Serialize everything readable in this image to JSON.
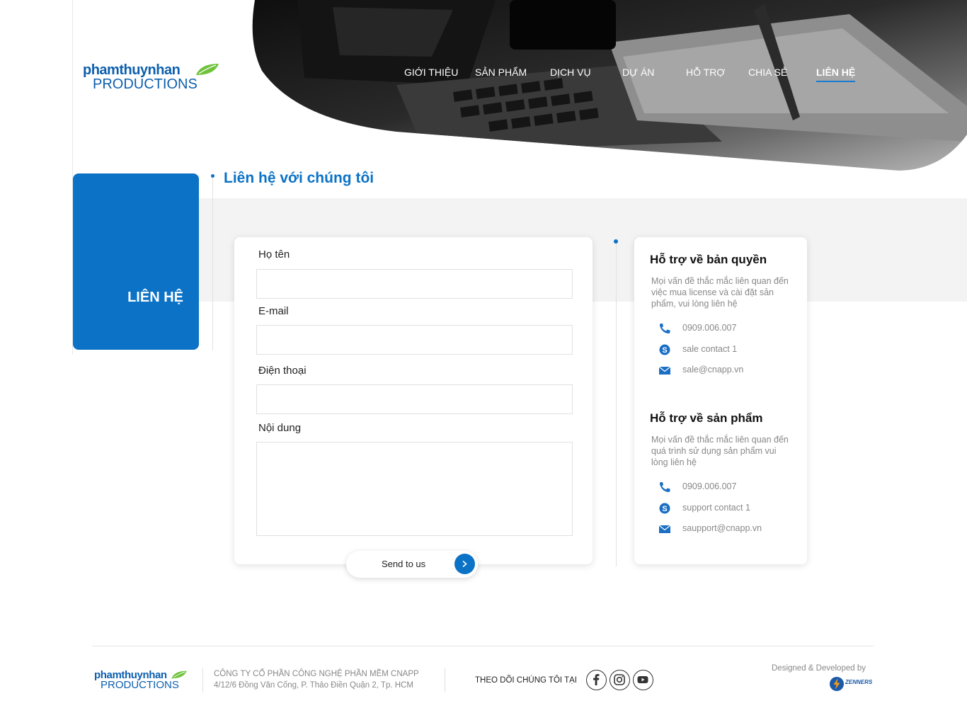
{
  "brand": {
    "line1": "phamthuynhan",
    "line2": "PRODUCTIONS",
    "color": "#0d5fae",
    "leaf_color": "#6fc23a"
  },
  "nav": {
    "items": [
      {
        "label": "GIỚI THIỆU",
        "active": false
      },
      {
        "label": "SẢN PHẨM",
        "active": false
      },
      {
        "label": "DỊCH VỤ",
        "active": false
      },
      {
        "label": "DỰ ÁN",
        "active": false
      },
      {
        "label": "HỖ TRỢ",
        "active": false
      },
      {
        "label": "CHIA SẺ",
        "active": false
      },
      {
        "label": "LIÊN HỆ",
        "active": true
      }
    ]
  },
  "sidebar": {
    "title": "LIÊN HỆ"
  },
  "page": {
    "title": "Liên hệ với chúng tôi",
    "accent": "#0b72c6"
  },
  "form": {
    "name_label": "Họ tên",
    "name_value": "",
    "email_label": "E-mail",
    "email_value": "",
    "phone_label": "Điện thoại",
    "phone_value": "",
    "content_label": "Nội dung",
    "content_value": "",
    "submit_label": "Send to us",
    "submit_icon": "chevron-right-icon"
  },
  "support": [
    {
      "title": "Hỗ trợ về bản quyền",
      "description": "Mọi vấn đề thắc mắc liên quan đến việc mua license và cài đặt sản phẩm, vui lòng liên hệ",
      "contacts": [
        {
          "icon": "phone-icon",
          "text": "0909.006.007"
        },
        {
          "icon": "skype-icon",
          "text": "sale contact 1"
        },
        {
          "icon": "email-icon",
          "text": "sale@cnapp.vn"
        }
      ]
    },
    {
      "title": "Hỗ trợ về sản phẩm",
      "description": "Mọi vấn đề thắc mắc liên quan đến quá trình sử dụng sản phẩm vui lòng liên hệ",
      "contacts": [
        {
          "icon": "phone-icon",
          "text": "0909.006.007"
        },
        {
          "icon": "skype-icon",
          "text": "support contact 1"
        },
        {
          "icon": "email-icon",
          "text": "saupport@cnapp.vn"
        }
      ]
    }
  ],
  "footer": {
    "company": "CÔNG TY CỔ PHẦN CÔNG NGHỆ PHẦN MỀM CNAPP",
    "address": "4/12/6 Đồng Văn Cống, P. Thảo Điền Quận 2, Tp. HCM",
    "follow_label": "THEO DÕI CHÚNG TÔI TẠI",
    "social": [
      "facebook-icon",
      "instagram-icon",
      "youtube-icon"
    ],
    "designed_by": "Designed & Developed by",
    "developer": "ZENNERS"
  }
}
